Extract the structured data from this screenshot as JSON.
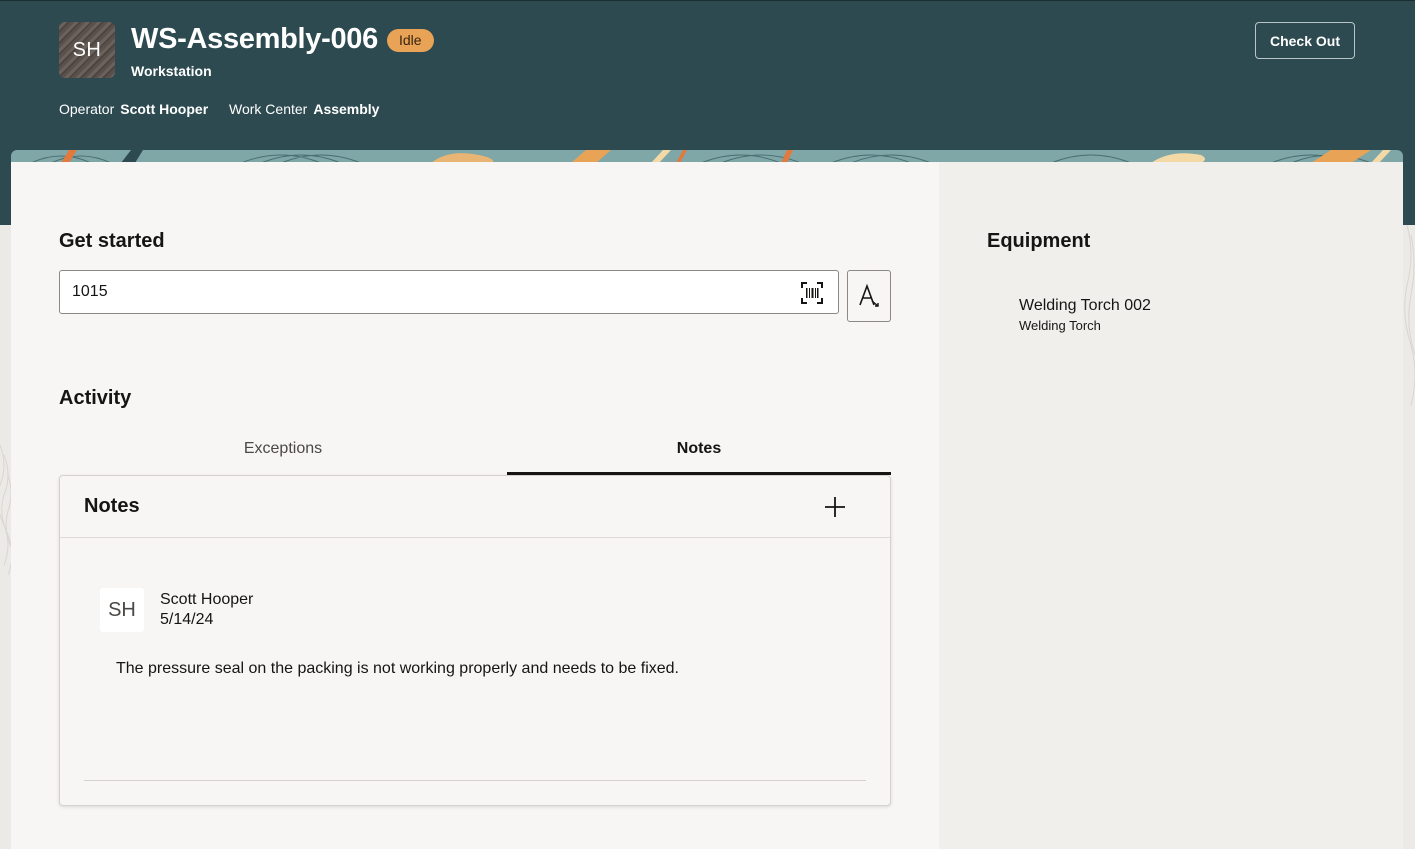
{
  "header": {
    "avatar_initials": "SH",
    "title": "WS-Assembly-006",
    "status": "Idle",
    "subtitle": "Workstation",
    "operator_label": "Operator",
    "operator_value": "Scott Hooper",
    "work_center_label": "Work Center",
    "work_center_value": "Assembly",
    "check_out_label": "Check Out",
    "status_color": "#e8a356",
    "bg_color": "#2c4a50"
  },
  "get_started": {
    "title": "Get started",
    "input_value": "1015",
    "barcode_icon": "barcode-scan-icon",
    "text_icon": "text-size-icon"
  },
  "activity": {
    "title": "Activity",
    "tabs": [
      {
        "label": "Exceptions",
        "active": false
      },
      {
        "label": "Notes",
        "active": true
      }
    ]
  },
  "notes": {
    "title": "Notes",
    "add_icon": "plus-icon",
    "items": [
      {
        "initials": "SH",
        "author": "Scott Hooper",
        "date": "5/14/24",
        "text": "The pressure seal on the packing is not working properly and needs to be fixed."
      }
    ]
  },
  "equipment": {
    "title": "Equipment",
    "items": [
      {
        "name": "Welding Torch 002",
        "type": "Welding Torch"
      }
    ]
  }
}
